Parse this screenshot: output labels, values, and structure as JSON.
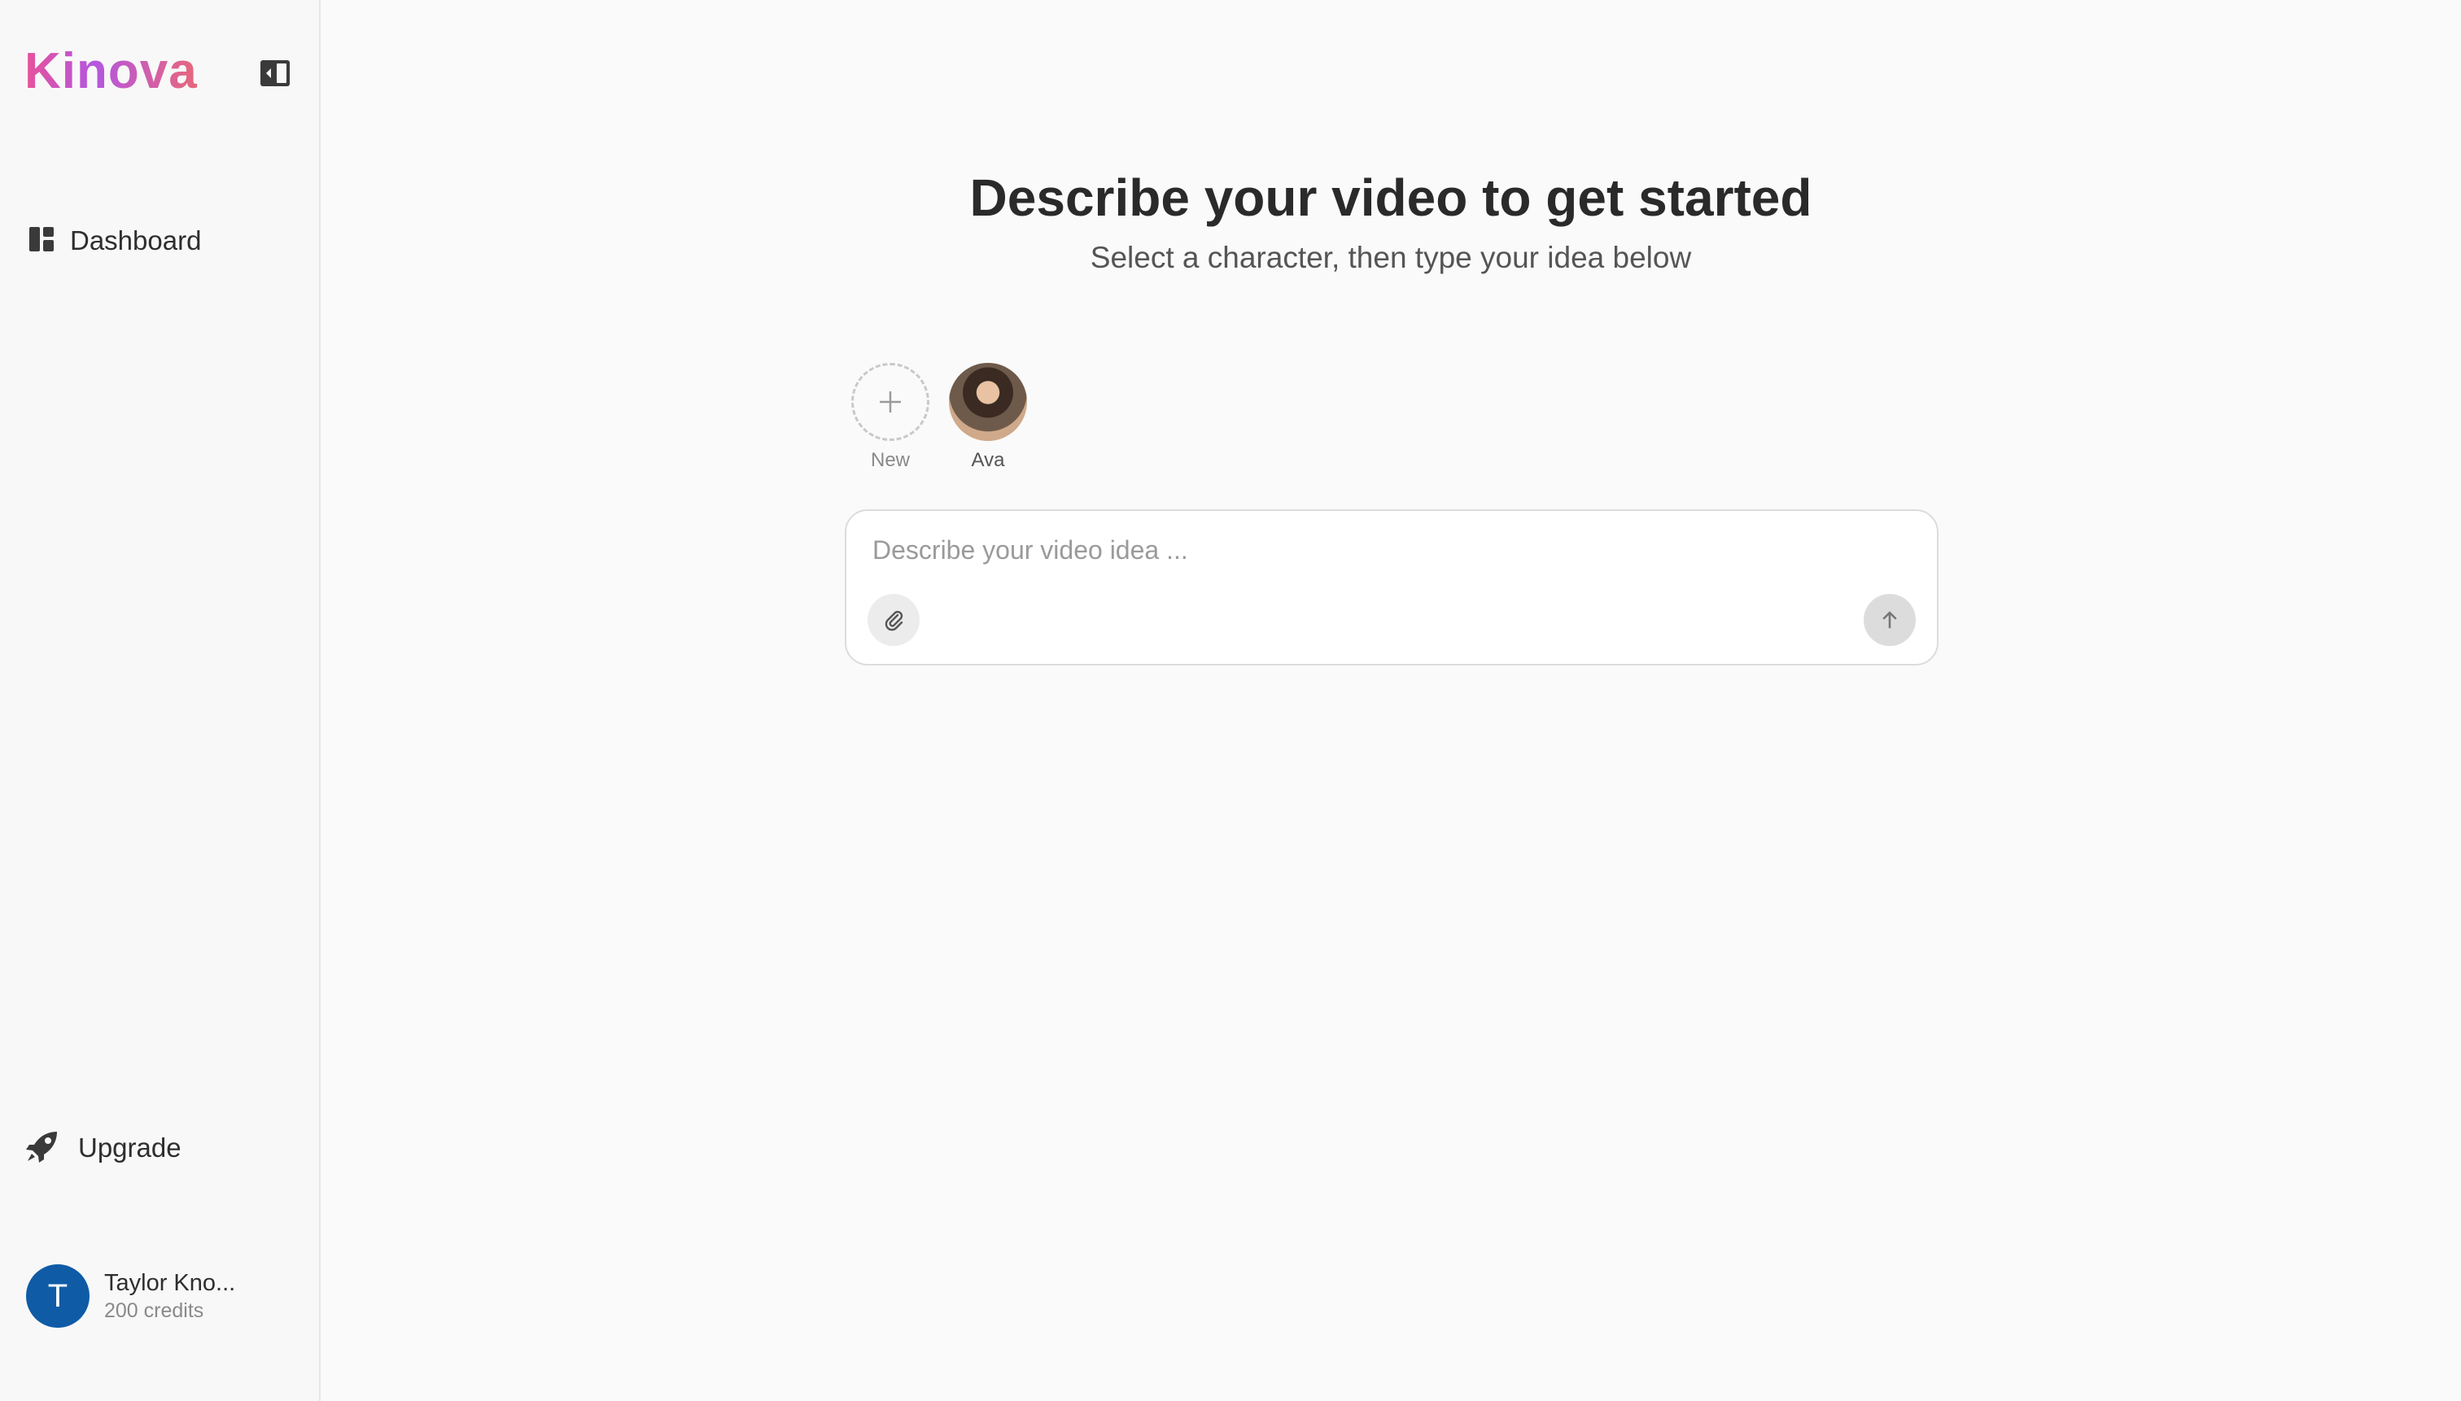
{
  "sidebar": {
    "logo_text": "Kinova",
    "collapse_icon": "sidebar-collapse-icon",
    "nav": [
      {
        "label": "Dashboard",
        "icon": "dashboard-icon"
      }
    ],
    "upgrade": {
      "label": "Upgrade",
      "icon": "rocket-icon"
    },
    "user": {
      "initial": "T",
      "name": "Taylor Kno...",
      "credits": "200 credits",
      "avatar_color": "#0f5ba6"
    }
  },
  "main": {
    "heading": "Describe your video to get started",
    "subheading": "Select a character, then type your idea below",
    "characters": [
      {
        "label": "New",
        "icon": "plus-icon"
      },
      {
        "label": "Ava",
        "icon": "character-avatar"
      }
    ],
    "prompt": {
      "placeholder": "Describe your video idea ...",
      "value": "",
      "attach_icon": "paperclip-icon",
      "send_icon": "arrow-up-icon"
    }
  },
  "colors": {
    "brand_gradient": [
      "#e8519a",
      "#b456e0",
      "#e8677a"
    ],
    "background": "#fafafa"
  }
}
